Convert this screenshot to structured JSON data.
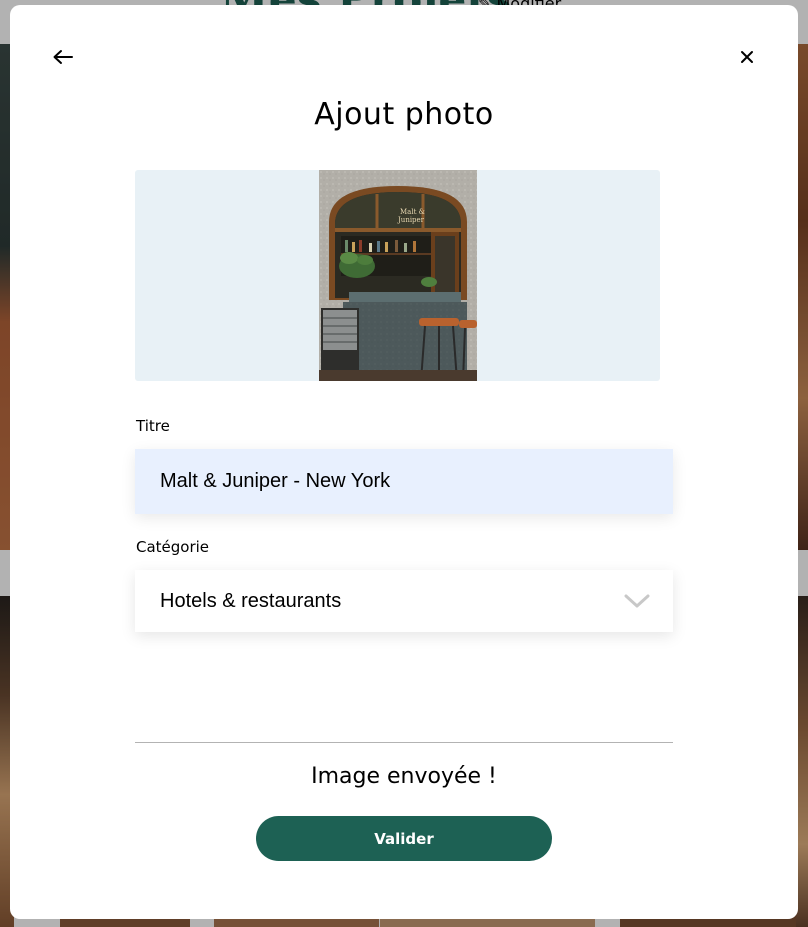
{
  "background": {
    "page_title": "Mes Projets",
    "edit_label": "Modifier"
  },
  "modal": {
    "back_icon": "arrow-left-icon",
    "close_icon": "close-icon",
    "title": "Ajout photo",
    "preview": {
      "image_sign_text": "Malt & Juniper"
    },
    "title_field": {
      "label": "Titre",
      "value": "Malt & Juniper - New York"
    },
    "category_field": {
      "label": "Catégorie",
      "value": "Hotels & restaurants",
      "icon": "chevron-down-icon"
    },
    "status": "Image envoyée !",
    "submit_label": "Valider"
  },
  "colors": {
    "brand": "#1d6154",
    "preview_bg": "#e8f1f6",
    "input_bg": "#e8f0fe",
    "overlay": "rgba(0,0,0,0.3)"
  }
}
